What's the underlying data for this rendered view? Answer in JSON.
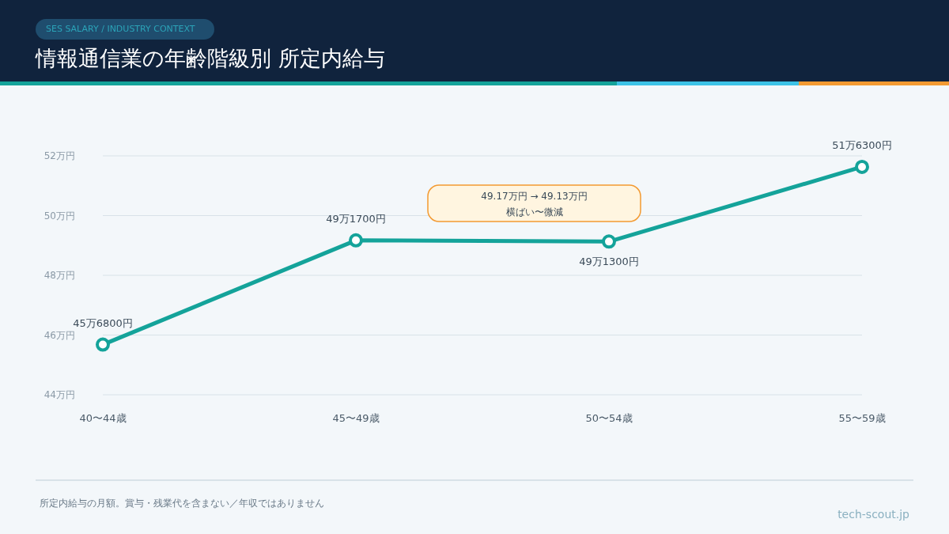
{
  "header": {
    "tag": "SES SALARY / INDUSTRY CONTEXT",
    "title": "情報通信業の年齢階級別 所定内給与"
  },
  "chart": {
    "chart_data": {
      "type": "line",
      "categories": [
        "40〜44歳",
        "45〜49歳",
        "50〜54歳",
        "55〜59歳"
      ],
      "series": [
        {
          "color": "#14a39a",
          "marker": "circle",
          "values": [
            45.68,
            49.17,
            49.13,
            51.63
          ]
        }
      ],
      "ylim": [
        44,
        52
      ],
      "yticks": [
        {
          "value": 44,
          "label": "44万円"
        },
        {
          "value": 46,
          "label": "46万円"
        },
        {
          "value": 48,
          "label": "48万円"
        },
        {
          "value": 50,
          "label": "50万円"
        },
        {
          "value": 52,
          "label": "52万円"
        }
      ],
      "grid": true,
      "value_labels": [
        "45万6800円",
        "49万1700円",
        "49万1300円",
        "51万6300円"
      ],
      "annotations": [
        {
          "text": "49.17万円 → 49.13万円"
        },
        {
          "text": "横ばい〜微減"
        }
      ]
    }
  },
  "footer": {
    "note": "所定内給与の月額。賞与・残業代を含まない／年収ではありません",
    "source": "tech-scout.jp"
  }
}
